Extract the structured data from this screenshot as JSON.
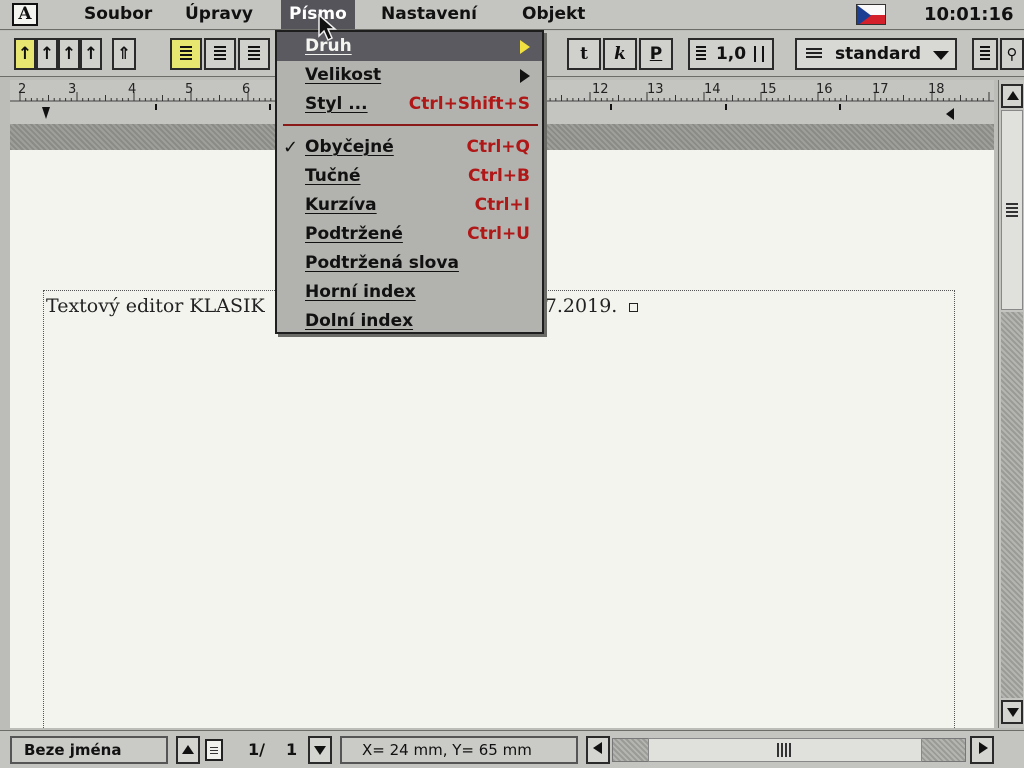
{
  "menubar": {
    "app_logo": "A",
    "items": [
      "Soubor",
      "Úpravy",
      "Písmo",
      "Nastavení",
      "Objekt"
    ],
    "active_item": "Písmo",
    "clock": "10:01:16"
  },
  "toolbar": {
    "line_spacing_value": "1,0",
    "style_value": "standard",
    "bold_label": "t",
    "italic_label": "k",
    "underline_label": "P"
  },
  "ruler": {
    "numbers": [
      "2",
      "3",
      "4",
      "5",
      "6",
      "12",
      "13",
      "14",
      "15",
      "16",
      "17",
      "18"
    ]
  },
  "document": {
    "text_left": "Textový editor KLASIK",
    "text_right": ".7.2019."
  },
  "dropdown": {
    "items": [
      {
        "label": "Druh",
        "shortcut": "",
        "submenu": true,
        "highlighted": true,
        "checked": false
      },
      {
        "label": "Velikost",
        "shortcut": "",
        "submenu": true,
        "highlighted": false,
        "checked": false
      },
      {
        "label": "Styl ...",
        "shortcut": "Ctrl+Shift+S",
        "submenu": false,
        "highlighted": false,
        "checked": false
      },
      {
        "label": "Obyčejné",
        "shortcut": "Ctrl+Q",
        "submenu": false,
        "highlighted": false,
        "checked": true
      },
      {
        "label": "Tučné",
        "shortcut": "Ctrl+B",
        "submenu": false,
        "highlighted": false,
        "checked": false
      },
      {
        "label": "Kurzíva",
        "shortcut": "Ctrl+I",
        "submenu": false,
        "highlighted": false,
        "checked": false
      },
      {
        "label": "Podtržené",
        "shortcut": "Ctrl+U",
        "submenu": false,
        "highlighted": false,
        "checked": false
      },
      {
        "label": "Podtržená slova",
        "shortcut": "",
        "submenu": false,
        "highlighted": false,
        "checked": false
      },
      {
        "label": "Horní index",
        "shortcut": "",
        "submenu": false,
        "highlighted": false,
        "checked": false
      },
      {
        "label": "Dolní index",
        "shortcut": "",
        "submenu": false,
        "highlighted": false,
        "checked": false
      }
    ],
    "check_mark": "✓"
  },
  "statusbar": {
    "filename": "Beze jména",
    "page_current": "1/",
    "page_total": "1",
    "position": "X= 24 mm, Y= 65 mm"
  },
  "colors": {
    "highlight": "#5a5a60",
    "shortcut": "#b01818",
    "toolbar_active": "#e6e670"
  }
}
